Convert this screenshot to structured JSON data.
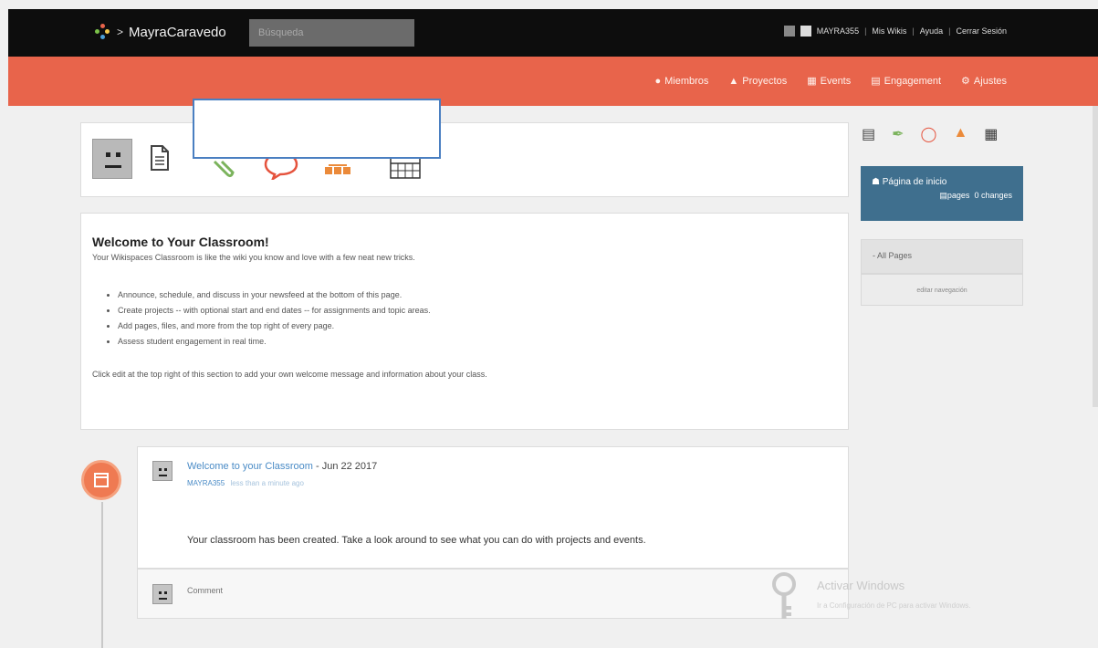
{
  "topbar": {
    "brand": "MayraCaravedo",
    "search_placeholder": "Búsqueda",
    "username": "MAYRA355",
    "links": [
      "Mis Wikis",
      "Ayuda",
      "Cerrar Sesión"
    ]
  },
  "nav": {
    "items": [
      {
        "icon": "members-icon",
        "label": "Miembros"
      },
      {
        "icon": "projects-icon",
        "label": "Proyectos"
      },
      {
        "icon": "events-icon",
        "label": "Events"
      },
      {
        "icon": "engagement-icon",
        "label": "Engagement"
      },
      {
        "icon": "settings-icon",
        "label": "Ajustes"
      }
    ]
  },
  "welcome": {
    "title": "Welcome to Your Classroom!",
    "subtitle": "Your Wikispaces Classroom is like the wiki you know and love with a few neat new tricks.",
    "bullets": [
      "Announce, schedule, and discuss in your newsfeed at the bottom of this page.",
      "Create projects -- with optional start and end dates -- for assignments and topic areas.",
      "Add pages, files, and more from the top right of every page.",
      "Assess student engagement in real time."
    ],
    "footer": "Click edit at the top right of this section to add your own welcome message and information about your class."
  },
  "post": {
    "title_link": "Welcome to your Classroom",
    "date": " - Jun 22 2017",
    "user": "MAYRA355",
    "time": "less than a minute ago",
    "body": "Your classroom has been created. Take a look around to see what you can do with projects and events.",
    "comment_placeholder": "Comment"
  },
  "sidebar": {
    "home_title": "Página de inicio",
    "pages_label": "pages",
    "changes_label": "0 changes",
    "all_pages": "- All Pages",
    "edit_nav": "editar navegación"
  },
  "watermark": {
    "title": "Activar Windows",
    "subtitle": "Ir a Configuración de PC para activar Windows."
  },
  "colors": {
    "topbar": "#0d0d0d",
    "nav": "#e8644b",
    "home_box": "#3f6f8e",
    "link": "#4a8bc6"
  }
}
